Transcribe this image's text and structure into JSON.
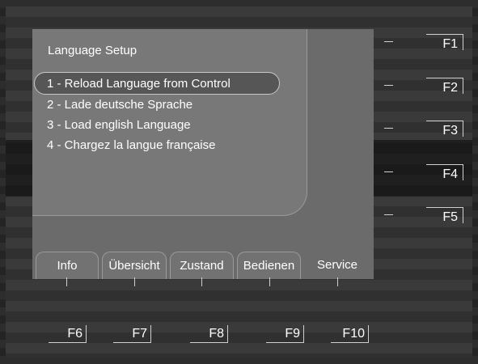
{
  "title": "Language Setup",
  "menu_items": [
    "1 - Reload Language from Control",
    "2 - Lade deutsche Sprache",
    "3 - Load english Language",
    "4 - Chargez la langue française"
  ],
  "selected_item": 0,
  "tabs": [
    "Info",
    "Übersicht",
    "Zustand",
    "Bedienen",
    "Service"
  ],
  "active_tab": "Service",
  "right_keys": [
    "F1",
    "F2",
    "F3",
    "F4",
    "F5"
  ],
  "bottom_keys": [
    "F6",
    "F7",
    "F8",
    "F9",
    "F10"
  ]
}
